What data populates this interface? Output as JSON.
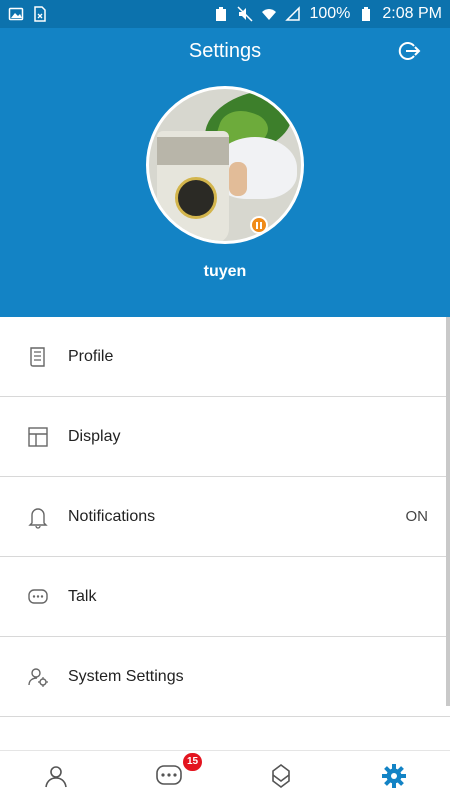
{
  "status_bar": {
    "battery": "100%",
    "time": "2:08 PM"
  },
  "header": {
    "title": "Settings",
    "username": "tuyen"
  },
  "menu": [
    {
      "label": "Profile",
      "icon": "document-icon",
      "value": ""
    },
    {
      "label": "Display",
      "icon": "layout-icon",
      "value": ""
    },
    {
      "label": "Notifications",
      "icon": "bell-icon",
      "value": "ON"
    },
    {
      "label": "Talk",
      "icon": "chat-icon",
      "value": ""
    },
    {
      "label": "System Settings",
      "icon": "user-gear-icon",
      "value": ""
    }
  ],
  "bottom_nav": {
    "chat_badge": "15"
  },
  "colors": {
    "primary": "#1383c5",
    "statusbar": "#0c72ad",
    "badge": "#e3141f",
    "active_nav": "#1383c5"
  }
}
